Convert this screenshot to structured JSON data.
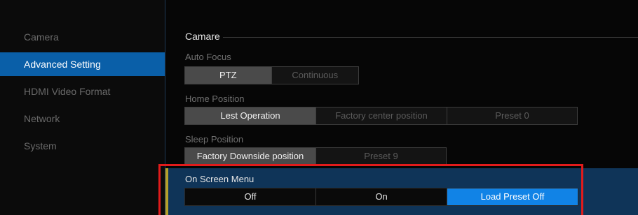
{
  "sidebar": {
    "items": [
      {
        "label": "Camera",
        "active": false
      },
      {
        "label": "Advanced Setting",
        "active": true
      },
      {
        "label": "HDMI Video Format",
        "active": false
      },
      {
        "label": "Network",
        "active": false
      },
      {
        "label": "System",
        "active": false
      }
    ]
  },
  "section": {
    "title": "Camare"
  },
  "settings": {
    "auto_focus": {
      "label": "Auto Focus",
      "options": [
        "PTZ",
        "Continuous"
      ],
      "selected": "PTZ"
    },
    "home_position": {
      "label": "Home Position",
      "options": [
        "Lest Operation",
        "Factory center position",
        "Preset 0"
      ],
      "selected": "Lest Operation"
    },
    "sleep_position": {
      "label": "Sleep Position",
      "options": [
        "Factory Downside position",
        "Preset 9"
      ],
      "selected": "Factory Downside position"
    },
    "on_screen_menu": {
      "label": "On Screen Menu",
      "options": [
        "Off",
        "On",
        "Load Preset Off"
      ],
      "selected": "Load Preset Off"
    }
  },
  "colors": {
    "accent_blue": "#0a5fa8",
    "selected_blue": "#1183e6",
    "highlight_red": "#e11b1b",
    "row_accent": "#b5a02a"
  }
}
